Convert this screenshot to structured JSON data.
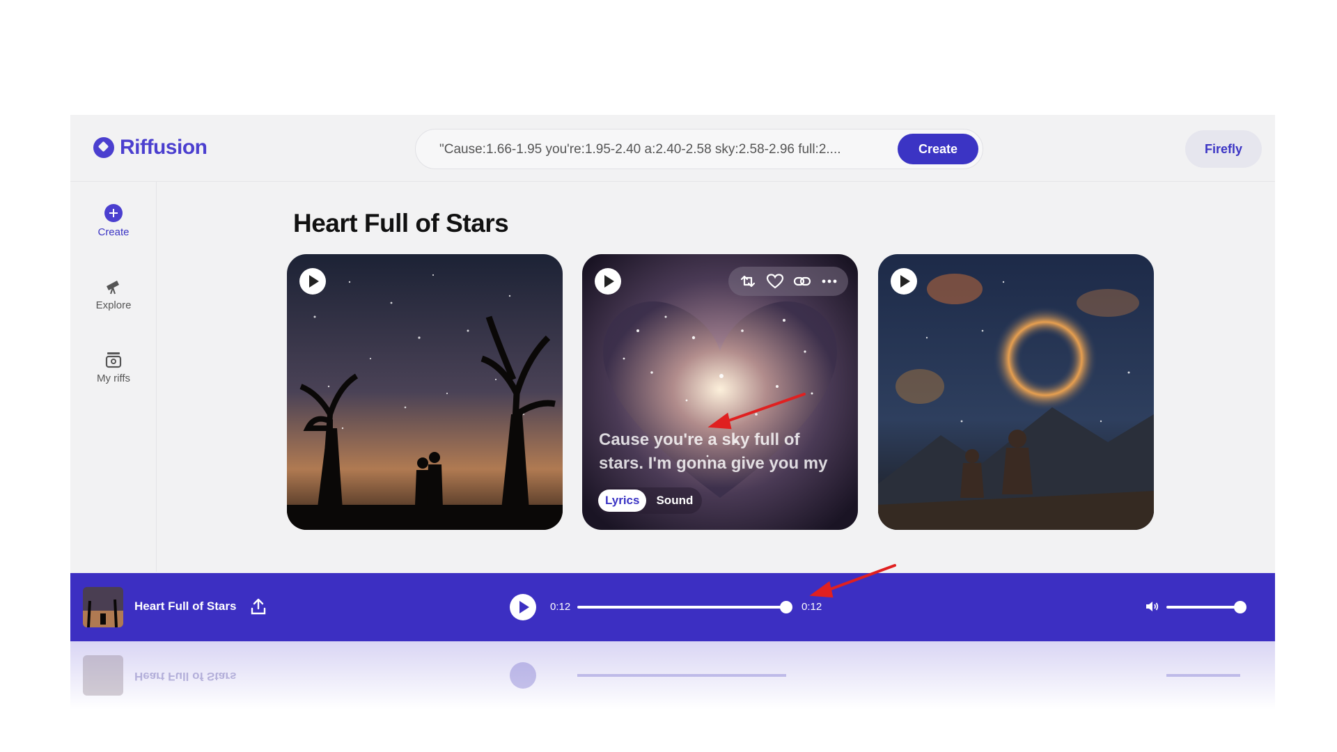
{
  "brand": {
    "name": "Riffusion"
  },
  "header": {
    "prompt_text": "\"Cause:1.66-1.95 you're:1.95-2.40 a:2.40-2.58 sky:2.58-2.96 full:2....",
    "create_label": "Create",
    "user_label": "Firefly"
  },
  "sidebar": {
    "items": [
      {
        "label": "Create",
        "icon": "plus-circle-icon",
        "active": true
      },
      {
        "label": "Explore",
        "icon": "telescope-icon",
        "active": false
      },
      {
        "label": "My riffs",
        "icon": "archive-box-icon",
        "active": false
      }
    ]
  },
  "main": {
    "title": "Heart Full of Stars",
    "cards": [
      {
        "art": "couple silhouette under starry sky with bare trees"
      },
      {
        "art": "heart-shaped star nebula",
        "lyrics": "Cause you're a sky full of stars. I'm gonna give you my",
        "tabs": [
          "Lyrics",
          "Sound"
        ],
        "actions": [
          "remix-icon",
          "heart-icon",
          "link-icon",
          "more-icon"
        ]
      },
      {
        "art": "couple watching nebula over mountains"
      }
    ]
  },
  "player": {
    "title": "Heart Full of Stars",
    "elapsed": "0:12",
    "duration": "0:12",
    "progress": 1.0,
    "volume": 1.0
  },
  "colors": {
    "accent": "#3c2fc2",
    "brand": "#4b3fcf",
    "annotation": "#e02020"
  }
}
